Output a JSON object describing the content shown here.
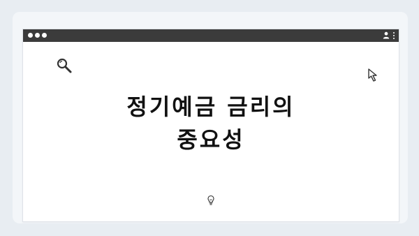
{
  "heading": {
    "line1": "정기예금 금리의",
    "line2": "중요성"
  },
  "icons": {
    "search": "search-icon",
    "cursor": "cursor-icon",
    "bulb": "lightbulb-icon",
    "user": "user-icon",
    "menu": "more-vertical-icon"
  },
  "colors": {
    "titlebar": "#3b3b3b",
    "background": "#e8edf2",
    "text": "#111111"
  }
}
